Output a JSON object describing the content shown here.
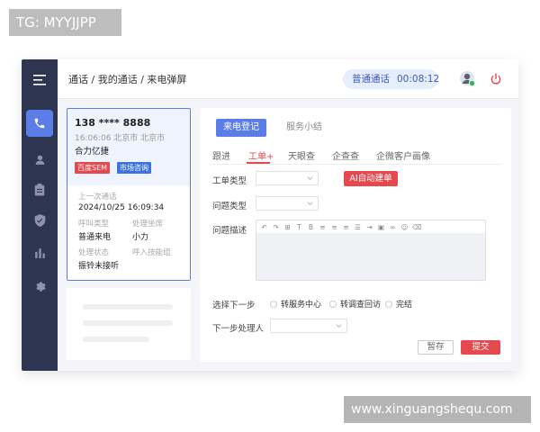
{
  "watermarks": {
    "top": "TG: MYYJJPP",
    "bottom": "www.xinguangshequ.com"
  },
  "sidebar": {
    "items": [
      {
        "icon": "menu-icon"
      },
      {
        "icon": "phone-icon",
        "active": true
      },
      {
        "icon": "user-icon"
      },
      {
        "icon": "clipboard-icon"
      },
      {
        "icon": "shield-icon"
      },
      {
        "icon": "bar-chart-icon"
      },
      {
        "icon": "gear-icon"
      }
    ]
  },
  "header": {
    "breadcrumb": "通话 / 我的通话 / 来电弹屏",
    "call_type": "普通通话",
    "timer": "00:08:12"
  },
  "caller": {
    "phone": "138 **** 8888",
    "time_location": "16:06:06  北京市 北京市",
    "company": "合力亿捷",
    "tags": [
      "百度SEM",
      "市场咨询"
    ],
    "last_call_label": "上一次通话",
    "last_call_value": "2024/10/25  16:09:34",
    "call_type_label": "呼叫类型",
    "call_type_value": "普通来电",
    "handler_label": "处理坐席",
    "handler_value": "小力",
    "status_label": "处理状态",
    "status_value": "振铃未接听",
    "skill_group_label": "呼入技能组"
  },
  "main": {
    "tabs": [
      "来电登记",
      "服务小结"
    ],
    "subtabs": [
      "跟进",
      "工单+",
      "天眼查",
      "企查查",
      "企微客户画像"
    ],
    "active_subtab": "工单+",
    "form": {
      "ticket_type_label": "工单类型",
      "issue_type_label": "问题类型",
      "issue_desc_label": "问题描述",
      "ai_button": "AI自动建单",
      "next_step_label": "选择下一步",
      "next_step_options": [
        "转服务中心",
        "转调查回访",
        "完结"
      ],
      "next_handler_label": "下一步处理人"
    },
    "editor_toolbar": [
      "undo-icon",
      "redo-icon",
      "format-icon",
      "text-icon",
      "bold-icon",
      "align-left-icon",
      "align-center-icon",
      "align-right-icon",
      "list-icon",
      "indent-icon",
      "image-icon",
      "link-icon",
      "emoji-icon",
      "delete-icon"
    ],
    "save_label": "暂存",
    "submit_label": "提交"
  },
  "colors": {
    "accent": "#5b7de8",
    "danger": "#e5484d",
    "sidebar": "#2e3550"
  }
}
